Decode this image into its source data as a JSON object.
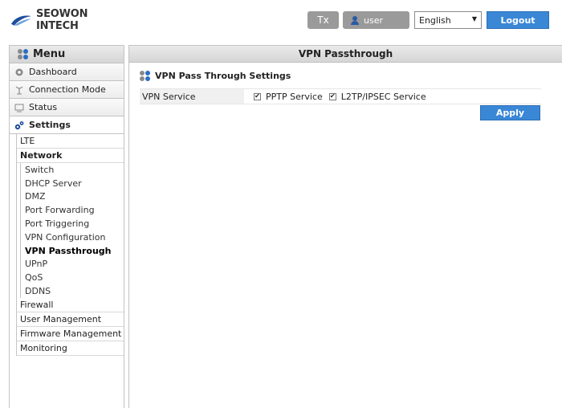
{
  "header": {
    "logo_text": "SEOWON INTECH",
    "signal_label": "Tx",
    "user_label": "user",
    "language": "English",
    "logout_label": "Logout"
  },
  "sidebar": {
    "menu_title": "Menu",
    "top_items": [
      {
        "label": "Dashboard",
        "icon": "gear-icon"
      },
      {
        "label": "Connection Mode",
        "icon": "antenna-icon"
      },
      {
        "label": "Status",
        "icon": "monitor-icon"
      },
      {
        "label": "Settings",
        "icon": "settings-gears-icon"
      }
    ],
    "settings_items": [
      "LTE",
      "Network"
    ],
    "network_items": [
      "Switch",
      "DHCP Server",
      "DMZ",
      "Port Forwarding",
      "Port Triggering",
      "VPN Configuration",
      "VPN Passthrough",
      "UPnP",
      "QoS",
      "DDNS"
    ],
    "settings_items_after": [
      "Firewall",
      "User Management",
      "Firmware Management",
      "Monitoring"
    ]
  },
  "main": {
    "title": "VPN Passthrough",
    "section_title": "VPN Pass Through Settings",
    "vpn_service_label": "VPN Service",
    "pptp_label": "PPTP Service",
    "pptp_checked": true,
    "l2tp_label": "L2TP/IPSEC Service",
    "l2tp_checked": true,
    "apply_label": "Apply"
  },
  "colors": {
    "accent": "#3a87d6",
    "gray_button": "#9a9a9a",
    "logo_blue": "#1f4e9b"
  }
}
